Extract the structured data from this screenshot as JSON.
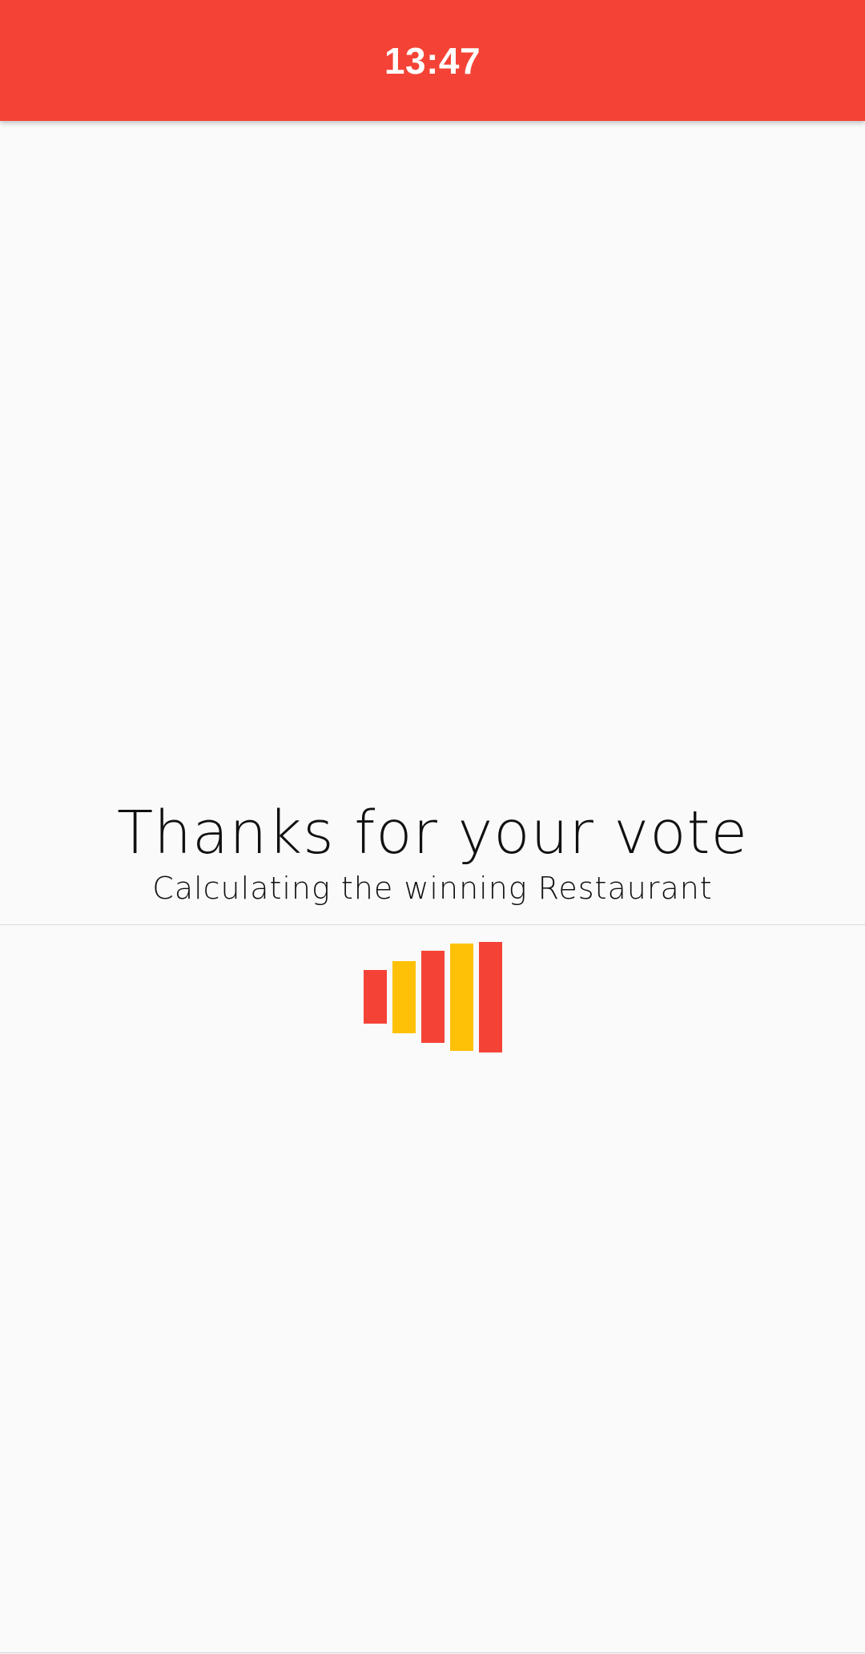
{
  "app_bar": {
    "time": "13:47",
    "color": "#f44336"
  },
  "message": {
    "title": "Thanks for your vote",
    "subtitle": "Calculating the winning Restaurant"
  },
  "loader": {
    "icon": "bar-loading-indicator-icon",
    "colors": {
      "red": "#f44336",
      "yellow": "#ffc107"
    }
  }
}
